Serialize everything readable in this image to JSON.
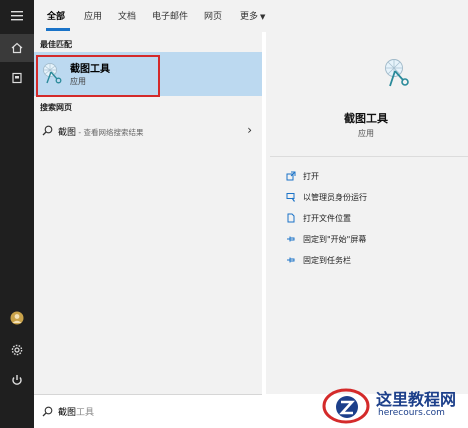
{
  "tabs": [
    {
      "label": "全部",
      "active": true
    },
    {
      "label": "应用",
      "active": false
    },
    {
      "label": "文档",
      "active": false
    },
    {
      "label": "电子邮件",
      "active": false
    },
    {
      "label": "网页",
      "active": false
    },
    {
      "label": "更多",
      "active": false
    }
  ],
  "rail": {
    "icons": [
      "menu-icon",
      "home-icon",
      "documents-icon",
      "avatar",
      "settings-icon",
      "power-icon"
    ]
  },
  "results": {
    "best_match_title": "最佳匹配",
    "best_match": {
      "name": "截图工具",
      "type": "应用",
      "icon": "snipping-tool-icon"
    },
    "web_title": "搜索网页",
    "web_item": {
      "query": "截图",
      "hint": " - 查看网络搜索结果"
    }
  },
  "preview": {
    "name": "截图工具",
    "type": "应用",
    "actions": [
      {
        "label": "打开",
        "icon": "open-icon"
      },
      {
        "label": "以管理员身份运行",
        "icon": "run-as-admin-icon"
      },
      {
        "label": "打开文件位置",
        "icon": "file-location-icon"
      },
      {
        "label": "固定到\"开始\"屏幕",
        "icon": "pin-start-icon"
      },
      {
        "label": "固定到任务栏",
        "icon": "pin-taskbar-icon"
      }
    ]
  },
  "search": {
    "value": "截图",
    "placeholder_rest": "工具"
  },
  "watermark": {
    "title": "这里教程网",
    "url": "herecours.com"
  },
  "colors": {
    "accent": "#1a73c8",
    "highlight": "#bcd9f0",
    "rail": "#1f1f1f",
    "annotation": "#d42a2a"
  }
}
